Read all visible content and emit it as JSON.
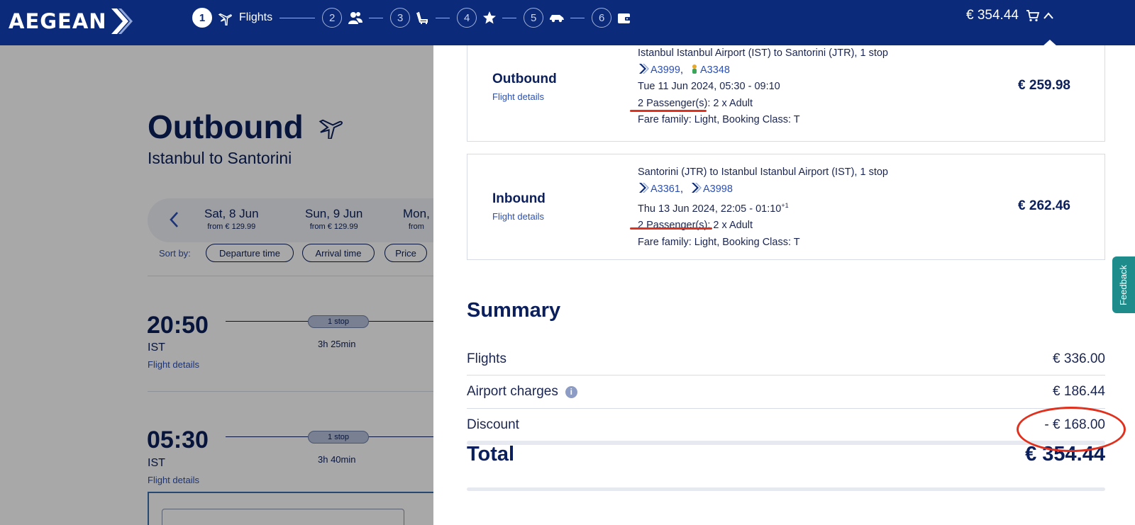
{
  "header": {
    "logo": "AEGEAN",
    "steps": [
      {
        "number": "1",
        "label": "Flights",
        "icon": "plane-icon",
        "active": true
      },
      {
        "number": "2",
        "icon": "passengers-icon"
      },
      {
        "number": "3",
        "icon": "seat-icon"
      },
      {
        "number": "4",
        "icon": "star-icon"
      },
      {
        "number": "5",
        "icon": "car-icon"
      },
      {
        "number": "6",
        "icon": "wallet-icon"
      }
    ],
    "cart_total": "€ 354.44"
  },
  "background_page": {
    "title": "Outbound",
    "subtitle": "Istanbul to Santorini",
    "dates": [
      {
        "label": "Sat, 8 Jun",
        "from": "from € 129.99"
      },
      {
        "label": "Sun, 9 Jun",
        "from": "from € 129.99"
      },
      {
        "label": "Mon,",
        "from": "from"
      }
    ],
    "sort_label": "Sort by:",
    "sort_options": [
      "Departure time",
      "Arrival time",
      "Price"
    ],
    "flights": [
      {
        "time": "20:50",
        "code": "IST",
        "link": "Flight details",
        "stops": "1 stop",
        "duration": "3h 25min"
      },
      {
        "time": "05:30",
        "code": "IST",
        "link": "Flight details",
        "stops": "1 stop",
        "duration": "3h 40min"
      }
    ]
  },
  "panel": {
    "outbound": {
      "direction": "Outbound",
      "link": "Flight details",
      "route": "Istanbul Istanbul Airport (IST) to Santorini (JTR), 1 stop",
      "flight1": "A3999",
      "separator": ",",
      "flight2": "A3348",
      "datetime": "Tue 11 Jun 2024, 05:30 - 09:10",
      "passengers_label": "2 Passenger(s)",
      "passengers_detail": ": 2 x Adult",
      "fare": "Fare family: Light, Booking Class: T",
      "price": "€ 259.98"
    },
    "inbound": {
      "direction": "Inbound",
      "link": "Flight details",
      "route": "Santorini (JTR) to Istanbul Istanbul Airport (IST), 1 stop",
      "flight1": "A3361",
      "separator": ",",
      "flight2": "A3998",
      "datetime": "Thu 13 Jun 2024, 22:05 - 01:10",
      "datetime_sup": "+1",
      "passengers_label": "2 Passenger(s)",
      "passengers_detail": ": 2 x Adult",
      "fare": "Fare family: Light, Booking Class: T",
      "price": "€ 262.46"
    },
    "summary": {
      "title": "Summary",
      "rows": [
        {
          "label": "Flights",
          "value": "€ 336.00"
        },
        {
          "label": "Airport charges",
          "value": "€ 186.44",
          "info_icon": "i"
        },
        {
          "label": "Discount",
          "value": "- € 168.00"
        }
      ],
      "total_label": "Total",
      "total_value": "€ 354.44"
    },
    "feedback_label": "Feedback"
  },
  "colors": {
    "brand_navy": "#0b2a7a",
    "link_blue": "#2b50b5",
    "annotation_red": "#e0301e",
    "feedback_teal": "#1f8c8c"
  }
}
